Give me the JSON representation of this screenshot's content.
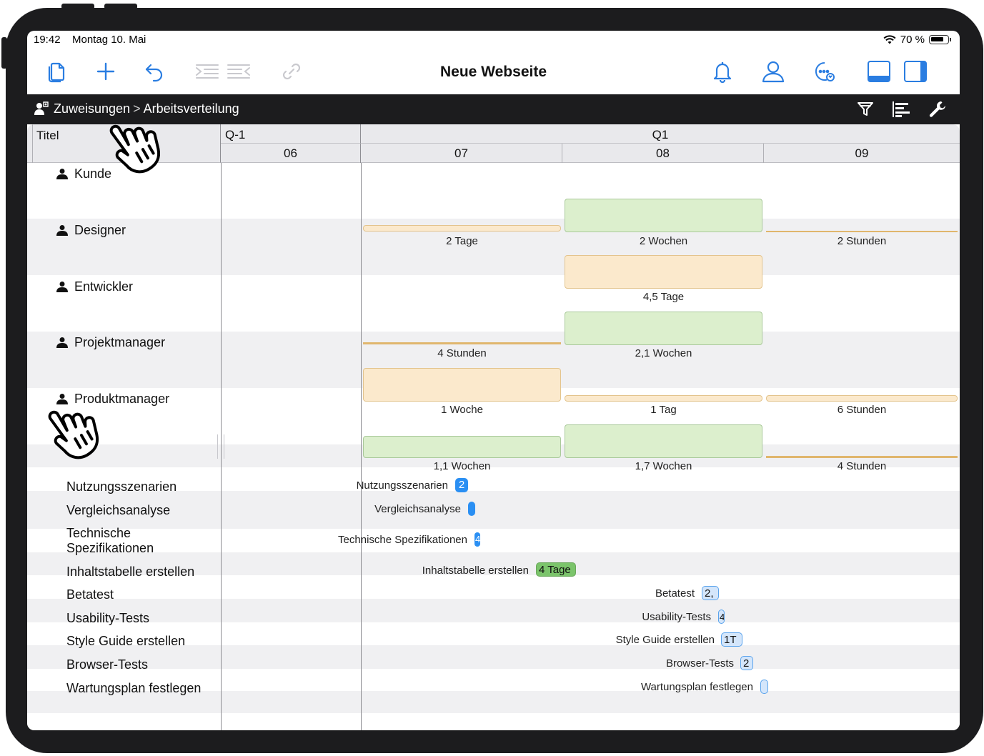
{
  "status_bar": {
    "time": "19:42",
    "date": "Montag 10. Mai",
    "battery": "70 %"
  },
  "toolbar": {
    "title": "Neue Webseite",
    "left_icons": [
      "documents-icon",
      "add-icon",
      "undo-icon",
      "indent-icon",
      "outdent-icon",
      "link-icon"
    ],
    "right_icons": [
      "bell-icon",
      "person-icon",
      "chat-sync-icon",
      "bottom-panel-icon",
      "side-panel-icon"
    ]
  },
  "breadcrumb": {
    "root": "Zuweisungen",
    "separator": ">",
    "current": "Arbeitsverteilung"
  },
  "actions": {
    "icons": [
      "filter-icon",
      "gantt-bars-icon",
      "wrench-icon"
    ]
  },
  "header": {
    "title_column": "Titel",
    "quarters": [
      "Q-1",
      "Q1"
    ],
    "months": [
      "06",
      "07",
      "08",
      "09"
    ]
  },
  "resources": [
    {
      "name": "Kunde",
      "expanded": false,
      "cells": [
        "2 Tage",
        "2 Wochen",
        "2 Stunden"
      ]
    },
    {
      "name": "Designer",
      "expanded": false,
      "cells": [
        "",
        "4,5 Tage",
        ""
      ]
    },
    {
      "name": "Entwickler",
      "expanded": false,
      "cells": [
        "4 Stunden",
        "2,1 Wochen",
        ""
      ]
    },
    {
      "name": "Projektmanager",
      "expanded": false,
      "cells": [
        "1 Woche",
        "1 Tag",
        "6 Stunden"
      ]
    },
    {
      "name": "Produktmanager",
      "expanded": true,
      "cells": [
        "1,1 Wochen",
        "1,7 Wochen",
        "4 Stunden"
      ]
    }
  ],
  "tasks": [
    {
      "title": "Nutzungsszenarien",
      "label": "Nutzungsszenarien",
      "badge": "2"
    },
    {
      "title": "Vergleichsanalyse",
      "label": "Vergleichsanalyse",
      "badge": ""
    },
    {
      "title_line1": "Technische",
      "title_line2": "Spezifikationen",
      "label": "Technische Spezifikationen",
      "badge": "4"
    },
    {
      "title": "Inhaltstabelle erstellen",
      "label": "Inhaltstabelle erstellen",
      "badge": "4 Tage"
    },
    {
      "title": "Betatest",
      "label": "Betatest",
      "badge": "2,"
    },
    {
      "title": "Usability-Tests",
      "label": "Usability-Tests",
      "badge": "4"
    },
    {
      "title": "Style Guide erstellen",
      "label": "Style Guide erstellen",
      "badge": "1T"
    },
    {
      "title": "Browser-Tests",
      "label": "Browser-Tests",
      "badge": "2"
    },
    {
      "title": "Wartungsplan festlegen",
      "label": "Wartungsplan festlegen",
      "badge": ""
    }
  ],
  "colors": {
    "bezel": "#1c1c1e",
    "accent": "#2a7de1",
    "green_bar": "#dcefcd",
    "orange_bar": "#fbe9cc",
    "badge_blue": "#2a8ff3",
    "badge_green": "#7bc46b"
  }
}
